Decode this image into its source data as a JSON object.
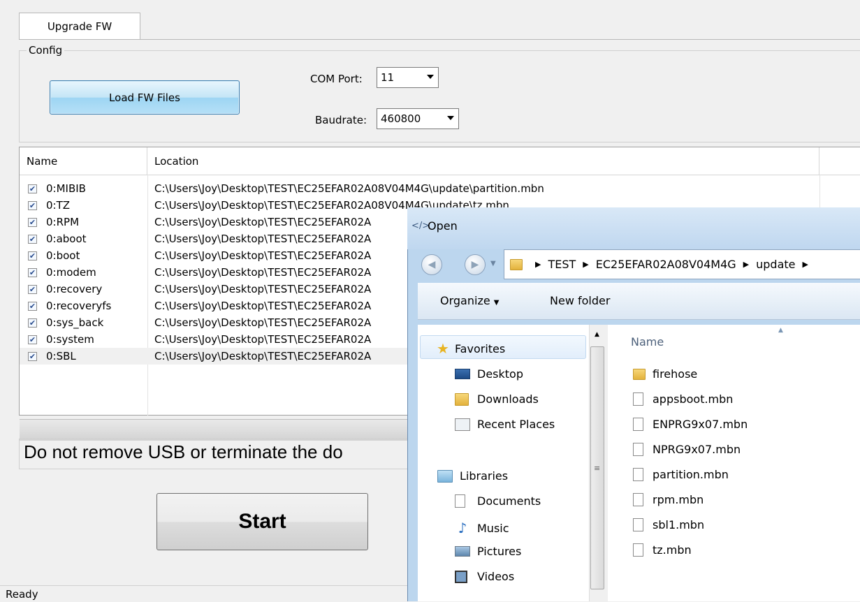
{
  "tab": {
    "label": "Upgrade FW"
  },
  "config": {
    "group_label": "Config",
    "load_button": "Load FW Files",
    "com_port_label": "COM Port:",
    "com_port_value": "11",
    "baudrate_label": "Baudrate:",
    "baudrate_value": "460800"
  },
  "table": {
    "headers": [
      "Name",
      "Location"
    ],
    "rows": [
      {
        "checked": true,
        "name": "0:MIBIB",
        "location": "C:\\Users\\Joy\\Desktop\\TEST\\EC25EFAR02A08V04M4G\\update\\partition.mbn"
      },
      {
        "checked": true,
        "name": "0:TZ",
        "location": "C:\\Users\\Joy\\Desktop\\TEST\\EC25EFAR02A08V04M4G\\update\\tz.mbn"
      },
      {
        "checked": true,
        "name": "0:RPM",
        "location": "C:\\Users\\Joy\\Desktop\\TEST\\EC25EFAR02A"
      },
      {
        "checked": true,
        "name": "0:aboot",
        "location": "C:\\Users\\Joy\\Desktop\\TEST\\EC25EFAR02A"
      },
      {
        "checked": true,
        "name": "0:boot",
        "location": "C:\\Users\\Joy\\Desktop\\TEST\\EC25EFAR02A"
      },
      {
        "checked": true,
        "name": "0:modem",
        "location": "C:\\Users\\Joy\\Desktop\\TEST\\EC25EFAR02A"
      },
      {
        "checked": true,
        "name": "0:recovery",
        "location": "C:\\Users\\Joy\\Desktop\\TEST\\EC25EFAR02A"
      },
      {
        "checked": true,
        "name": "0:recoveryfs",
        "location": "C:\\Users\\Joy\\Desktop\\TEST\\EC25EFAR02A"
      },
      {
        "checked": true,
        "name": "0:sys_back",
        "location": "C:\\Users\\Joy\\Desktop\\TEST\\EC25EFAR02A"
      },
      {
        "checked": true,
        "name": "0:system",
        "location": "C:\\Users\\Joy\\Desktop\\TEST\\EC25EFAR02A"
      },
      {
        "checked": true,
        "name": "0:SBL",
        "location": "C:\\Users\\Joy\\Desktop\\TEST\\EC25EFAR02A"
      }
    ]
  },
  "message": "Do not remove USB or terminate the do",
  "start_button": "Start",
  "status": "Ready",
  "dialog": {
    "title": "Open",
    "breadcrumb": [
      "TEST",
      "EC25EFAR02A08V04M4G",
      "update"
    ],
    "toolbar": {
      "organize": "Organize",
      "new_folder": "New folder"
    },
    "nav": {
      "favorites": "Favorites",
      "favorite_items": [
        "Desktop",
        "Downloads",
        "Recent Places"
      ],
      "libraries": "Libraries",
      "library_items": [
        "Documents",
        "Music",
        "Pictures",
        "Videos"
      ]
    },
    "column_header": "Name",
    "files": [
      "firehose",
      "appsboot.mbn",
      "ENPRG9x07.mbn",
      "NPRG9x07.mbn",
      "partition.mbn",
      "rpm.mbn",
      "sbl1.mbn",
      "tz.mbn"
    ]
  }
}
